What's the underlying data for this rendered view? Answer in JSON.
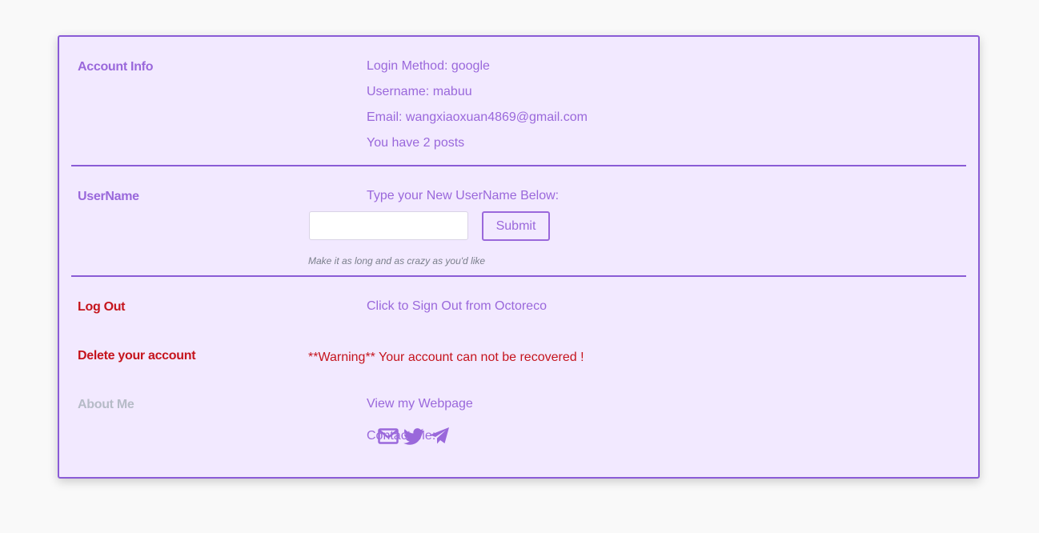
{
  "account_info": {
    "title": "Account Info",
    "login_method": "Login Method: google",
    "username": "Username: mabuu",
    "email": "Email: wangxiaoxuan4869@gmail.com",
    "posts": "You have 2 posts"
  },
  "username_section": {
    "title": "UserName",
    "prompt": "Type your New UserName Below:",
    "input_value": "",
    "submit_label": "Submit",
    "hint": "Make it as long and as crazy as you'd like"
  },
  "logout": {
    "title": "Log Out",
    "link": "Click to Sign Out from Octoreco"
  },
  "delete_account": {
    "title": "Delete your account",
    "warning": "**Warning** Your account can not be recovered !"
  },
  "about": {
    "title": "About Me",
    "webpage_link": "View my Webpage",
    "contact_label": "Contact Me:",
    "icons": [
      "mail-icon",
      "twitter-icon",
      "telegram-icon"
    ]
  },
  "colors": {
    "accent": "#9a68db",
    "border": "#8a5cd6",
    "card_bg": "#f2e9ff",
    "danger": "#c5141d",
    "muted": "#b6bbc7"
  }
}
